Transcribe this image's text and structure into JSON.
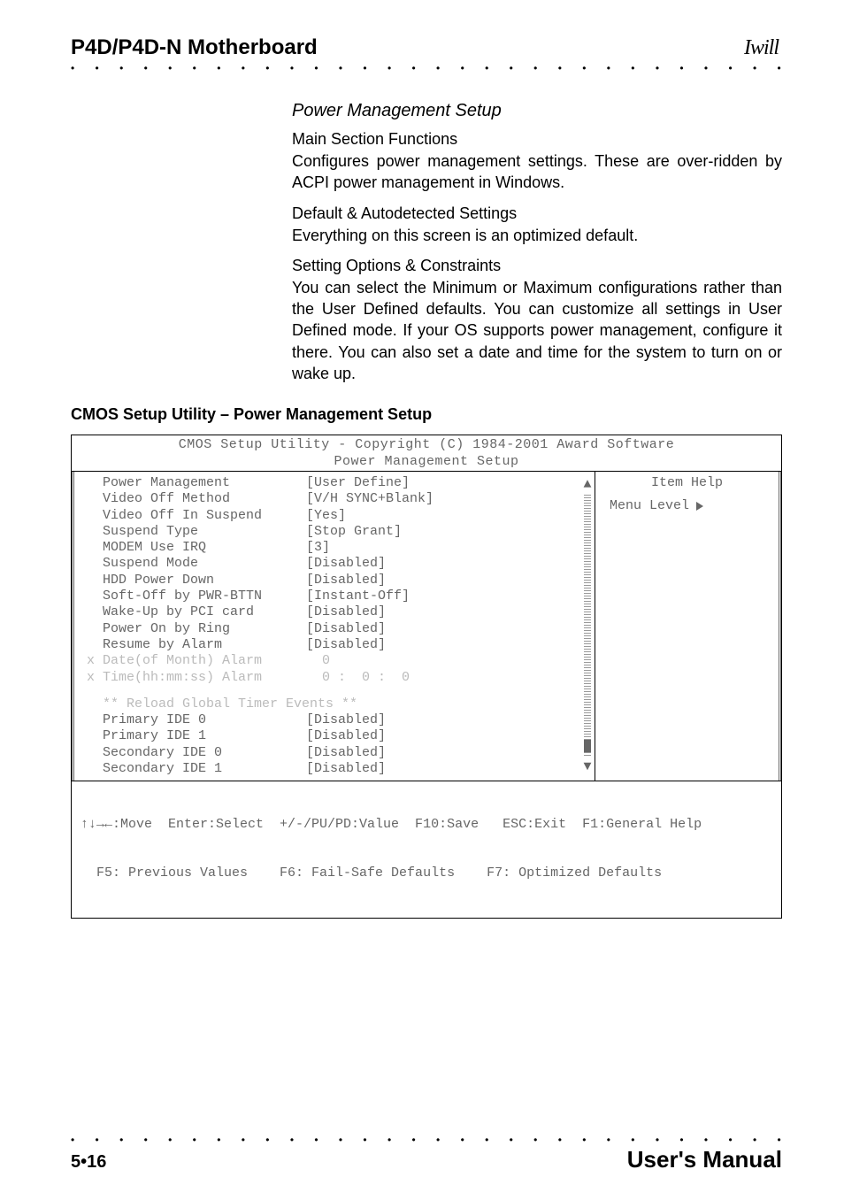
{
  "header": {
    "product": "P4D/P4D-N Motherboard",
    "logo": "Iwill"
  },
  "section": {
    "title": "Power Management Setup",
    "h1": "Main Section Functions",
    "p1": "Configures power management settings. These are over-ridden by ACPI power management in Windows.",
    "h2": "Default & Autodetected Settings",
    "p2": "Everything on this screen is an optimized default.",
    "h3": "Setting Options & Constraints",
    "p3": "You can select the Minimum or Maximum configurations rather than the User Defined defaults. You can customize all settings in User Defined mode. If your OS supports power management, configure it there. You can also set a date and time for the system to turn on or wake up."
  },
  "util_title": "CMOS Setup Utility – Power Management Setup",
  "bios": {
    "title1": "CMOS Setup Utility - Copyright (C) 1984-2001 Award Software",
    "title2": "Power Management Setup",
    "rows": [
      {
        "k": "Power Management",
        "v": "[User Define]"
      },
      {
        "k": "Video Off Method",
        "v": "[V/H SYNC+Blank]"
      },
      {
        "k": "Video Off In Suspend",
        "v": "[Yes]"
      },
      {
        "k": "Suspend Type",
        "v": "[Stop Grant]"
      },
      {
        "k": "MODEM Use IRQ",
        "v": "[3]"
      },
      {
        "k": "Suspend Mode",
        "v": "[Disabled]"
      },
      {
        "k": "HDD Power Down",
        "v": "[Disabled]"
      },
      {
        "k": "Soft-Off by PWR-BTTN",
        "v": "[Instant-Off]"
      },
      {
        "k": "Wake-Up by PCI card",
        "v": "[Disabled]"
      },
      {
        "k": "Power On by Ring",
        "v": "[Disabled]"
      },
      {
        "k": "Resume by Alarm",
        "v": "[Disabled]"
      }
    ],
    "dim_rows": [
      {
        "x": "x",
        "k": "Date(of Month) Alarm",
        "v": "  0"
      },
      {
        "x": "x",
        "k": "Time(hh:mm:ss) Alarm",
        "v": "  0 :  0 :  0"
      }
    ],
    "section_header": "** Reload Global Timer Events **",
    "rows2": [
      {
        "k": "Primary IDE 0",
        "v": "[Disabled]"
      },
      {
        "k": "Primary IDE 1",
        "v": "[Disabled]"
      },
      {
        "k": "Secondary IDE 0",
        "v": "[Disabled]"
      },
      {
        "k": "Secondary IDE 1",
        "v": "[Disabled]"
      }
    ],
    "help_title": "Item Help",
    "menu_level": "Menu Level",
    "footer1": "↑↓→←:Move  Enter:Select  +/-/PU/PD:Value  F10:Save   ESC:Exit  F1:General Help",
    "footer2": "  F5: Previous Values    F6: Fail-Safe Defaults    F7: Optimized Defaults"
  },
  "footer": {
    "page": "5•16",
    "manual": "User's Manual"
  }
}
